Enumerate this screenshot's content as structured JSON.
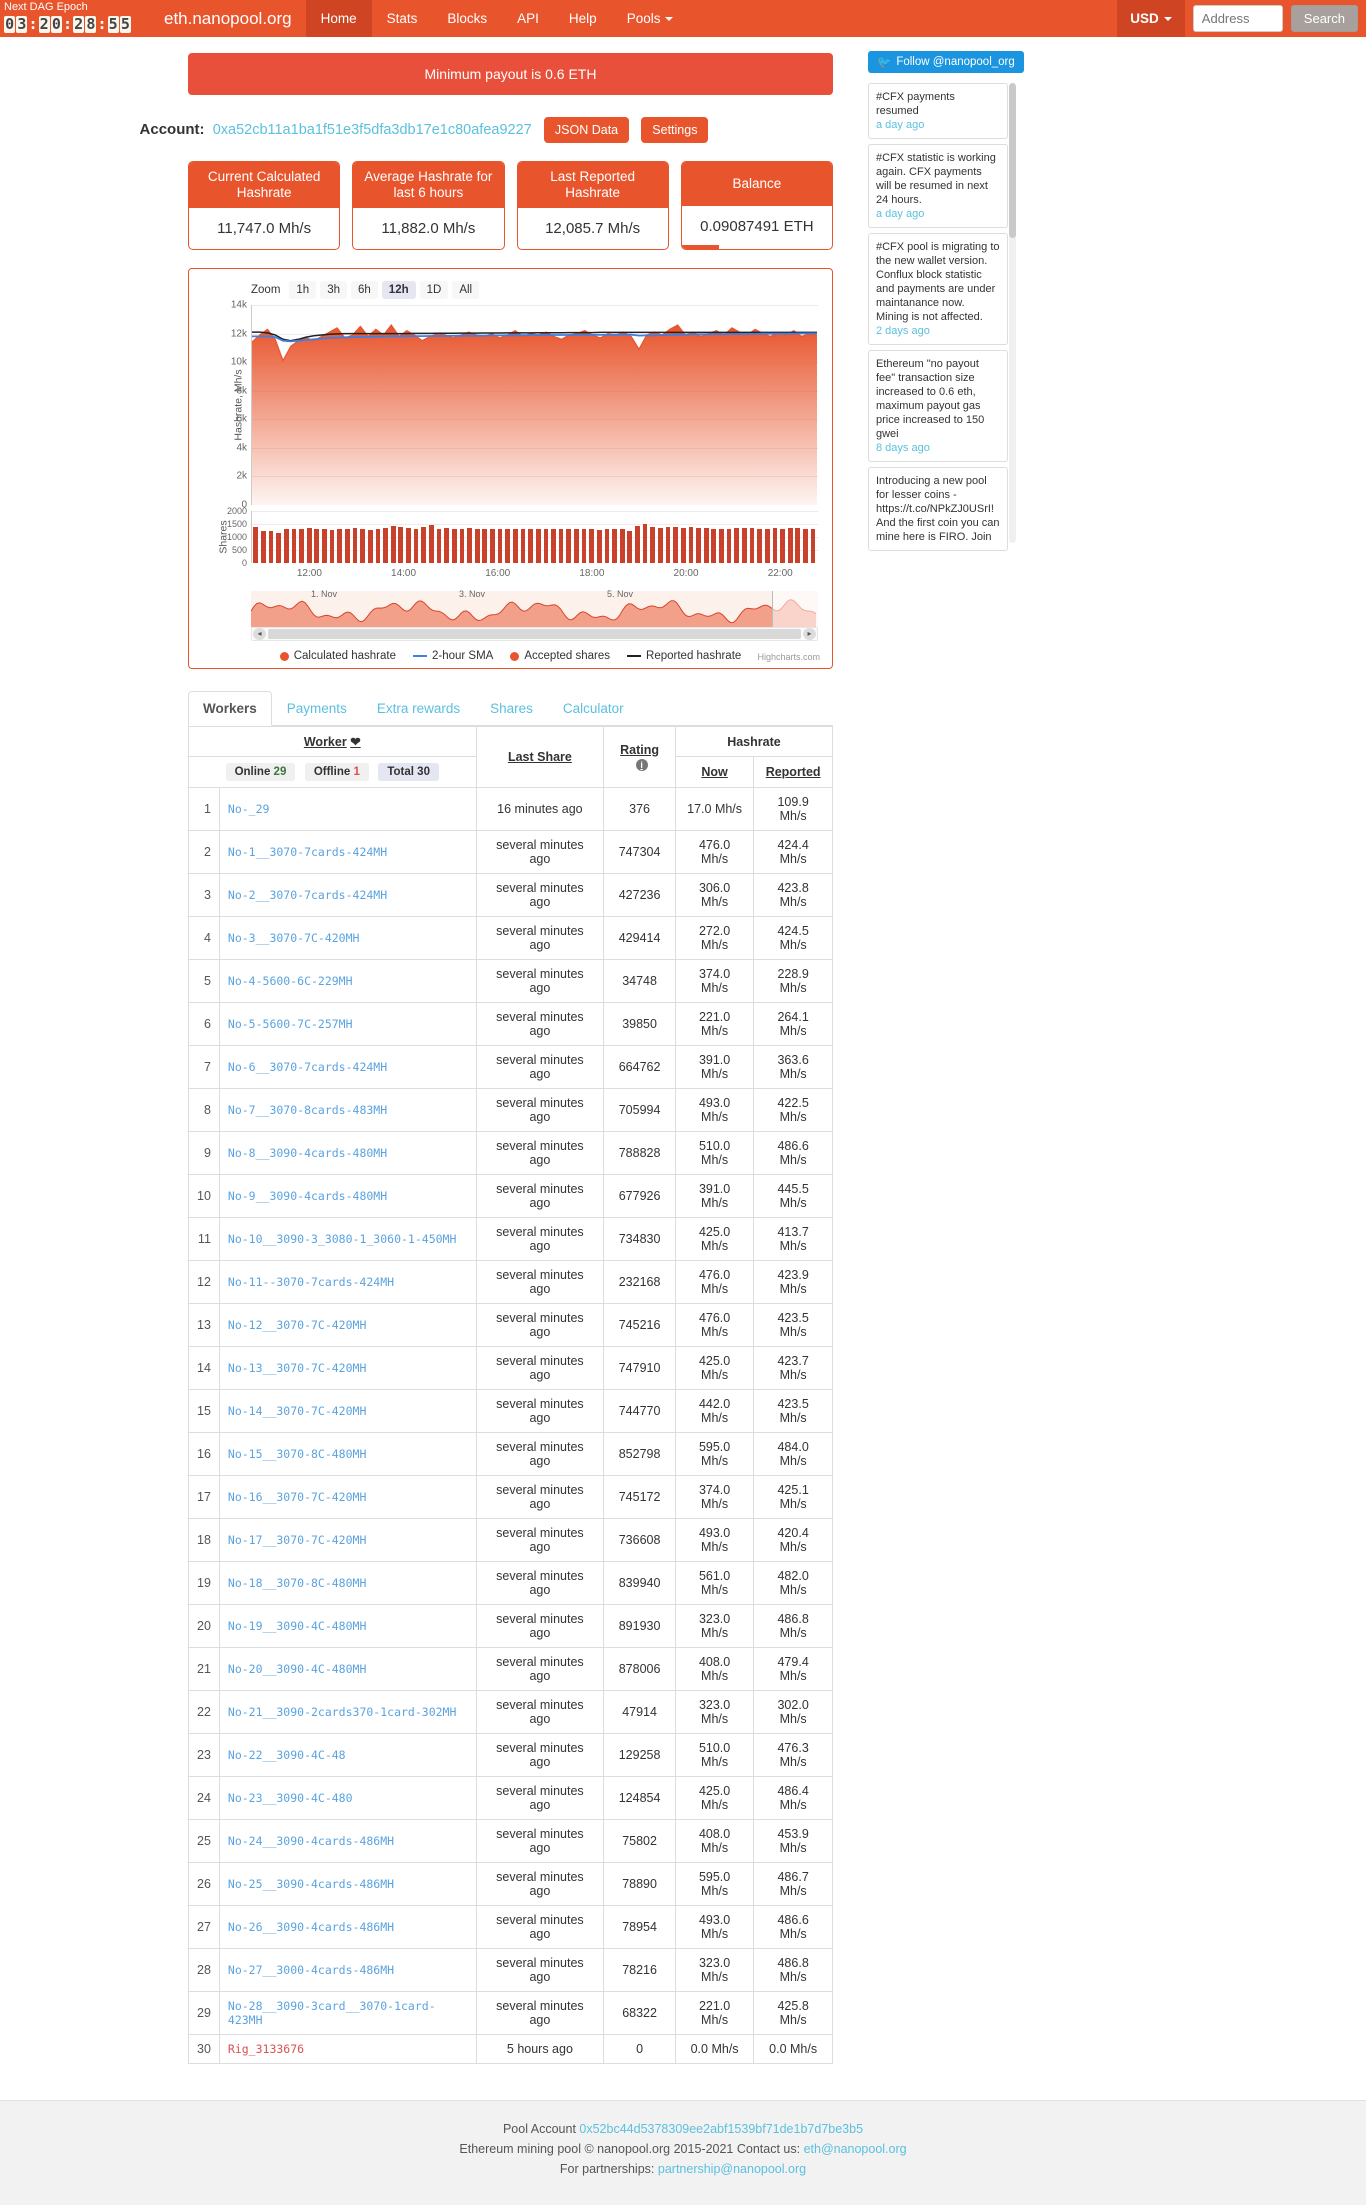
{
  "navbar": {
    "dag_title": "Next DAG Epoch",
    "dag_digits": [
      "0",
      "3",
      "2",
      "0",
      "2",
      "8",
      "5",
      "5"
    ],
    "brand": "eth.nanopool.org",
    "links": [
      {
        "label": "Home",
        "active": true
      },
      {
        "label": "Stats",
        "active": false
      },
      {
        "label": "Blocks",
        "active": false
      },
      {
        "label": "API",
        "active": false
      },
      {
        "label": "Help",
        "active": false
      },
      {
        "label": "Pools",
        "active": false,
        "caret": true
      }
    ],
    "currency": "USD",
    "address_placeholder": "Address",
    "search_label": "Search"
  },
  "banner": {
    "text": "Minimum payout is 0.6 ETH"
  },
  "account": {
    "label": "Account:",
    "address": "0xa52cb11a1ba1f51e3f5dfa3db17e1c80afea9227",
    "json_button": "JSON Data",
    "settings_button": "Settings"
  },
  "stats": [
    {
      "title": "Current Calculated Hashrate",
      "value": "11,747.0 Mh/s"
    },
    {
      "title": "Average Hashrate for last 6 hours",
      "value": "11,882.0 Mh/s"
    },
    {
      "title": "Last Reported Hashrate",
      "value": "12,085.7 Mh/s"
    },
    {
      "title": "Balance",
      "value": "0.09087491 ETH"
    }
  ],
  "chart_data": {
    "type": "area",
    "title": "",
    "zoom_label": "Zoom",
    "zoom_options": [
      "1h",
      "3h",
      "6h",
      "12h",
      "1D",
      "All"
    ],
    "zoom_selected": "12h",
    "ylabel": "Hashrate, Mh/s",
    "ylabel2": "Shares",
    "yticks": [
      "14k",
      "12k",
      "10k",
      "8k",
      "6k",
      "4k",
      "2k",
      "0"
    ],
    "ylim": [
      0,
      14000
    ],
    "yticks2": [
      "2000",
      "1500",
      "1000",
      "500",
      "0"
    ],
    "ylim2": [
      0,
      2000
    ],
    "xticks": [
      "12:00",
      "14:00",
      "16:00",
      "18:00",
      "20:00",
      "22:00"
    ],
    "xlabel": "",
    "grid": true,
    "legend_position": "bottom",
    "legend": [
      {
        "name": "Calculated hashrate",
        "marker": "dot",
        "color": "#e8552d"
      },
      {
        "name": "2-hour SMA",
        "marker": "line",
        "color": "#3f7fe0"
      },
      {
        "name": "Accepted shares",
        "marker": "dot",
        "color": "#e8552d"
      },
      {
        "name": "Reported hashrate",
        "marker": "line",
        "color": "#222222"
      }
    ],
    "credit": "Highcharts.com",
    "navigator_ticks": [
      "1. Nov",
      "3. Nov",
      "5. Nov"
    ],
    "series": [
      {
        "name": "Calculated hashrate",
        "color": "#e8552d",
        "values": [
          11400,
          11900,
          12300,
          11600,
          10100,
          11100,
          11500,
          11700,
          11500,
          11800,
          12100,
          12400,
          11700,
          11900,
          12500,
          11800,
          12300,
          11900,
          12600,
          11800,
          12200,
          11900,
          11500,
          11800,
          12000,
          11900,
          11700,
          11900,
          12100,
          11900,
          11800,
          12000,
          11700,
          11900,
          12200,
          11800,
          12000,
          11900,
          12100,
          11800,
          11600,
          11900,
          12000,
          12200,
          11900,
          11700,
          12000,
          11900,
          12100,
          11800,
          10900,
          11900,
          12100,
          11900,
          12300,
          12600,
          11900,
          12100,
          11800,
          12000,
          12200,
          11900,
          12400,
          12100,
          11900,
          12300,
          12000,
          11800,
          12100,
          11900,
          12200,
          11800,
          12000,
          11900
        ]
      },
      {
        "name": "2-hour SMA",
        "color": "#3f7fe0",
        "values": [
          11800,
          11800,
          11800,
          11750,
          11500,
          11450,
          11500,
          11550,
          11600,
          11650,
          11700,
          11720,
          11740,
          11750,
          11760,
          11770,
          11780,
          11790,
          11800,
          11800,
          11810,
          11820,
          11820,
          11830,
          11830,
          11840,
          11840,
          11850,
          11850,
          11860,
          11860,
          11870,
          11870,
          11880,
          11880,
          11890,
          11890,
          11900,
          11900,
          11900,
          11900,
          11900,
          11900,
          11910,
          11910,
          11910,
          11910,
          11920,
          11920,
          11920,
          11860,
          11870,
          11880,
          11890,
          11900,
          11920,
          11930,
          11940,
          11940,
          11950,
          11960,
          11960,
          11970,
          11970,
          11980,
          11980,
          11990,
          11990,
          12000,
          12000,
          12000,
          12010,
          12010,
          12010
        ]
      },
      {
        "name": "Reported hashrate",
        "color": "#222222",
        "values": [
          12100,
          12100,
          12050,
          11900,
          11600,
          11500,
          11600,
          11750,
          11850,
          11900,
          11950,
          11980,
          12000,
          12000,
          12000,
          12000,
          12000,
          12000,
          12000,
          12000,
          12000,
          12010,
          12010,
          12010,
          12020,
          12020,
          12020,
          12030,
          12030,
          12030,
          12040,
          12040,
          12040,
          12050,
          12050,
          12050,
          12050,
          12060,
          12060,
          12060,
          12060,
          12070,
          12070,
          12070,
          12070,
          12080,
          12080,
          12080,
          12080,
          12080,
          12080,
          12080,
          12080,
          12080,
          12080,
          12080,
          12080,
          12080,
          12080,
          12085,
          12085,
          12085,
          12085,
          12085,
          12085,
          12085,
          12085,
          12085,
          12085,
          12085,
          12085,
          12085,
          12085,
          12085
        ]
      },
      {
        "name": "Accepted shares",
        "color": "#c9412a",
        "type": "column",
        "values": [
          1390,
          1250,
          1240,
          1170,
          1300,
          1290,
          1290,
          1330,
          1320,
          1300,
          1280,
          1320,
          1290,
          1340,
          1300,
          1260,
          1290,
          1340,
          1420,
          1390,
          1350,
          1300,
          1370,
          1480,
          1300,
          1340,
          1300,
          1310,
          1330,
          1320,
          1310,
          1300,
          1290,
          1300,
          1310,
          1300,
          1310,
          1300,
          1290,
          1310,
          1300,
          1320,
          1310,
          1300,
          1290,
          1270,
          1300,
          1320,
          1310,
          1250,
          1420,
          1490,
          1370,
          1360,
          1380,
          1400,
          1360,
          1390,
          1330,
          1340,
          1300,
          1310,
          1320,
          1330,
          1340,
          1330,
          1320,
          1310,
          1330,
          1320,
          1340,
          1330,
          1320,
          1310
        ]
      }
    ]
  },
  "tabs": [
    {
      "label": "Workers",
      "active": true
    },
    {
      "label": "Payments",
      "active": false
    },
    {
      "label": "Extra rewards",
      "active": false
    },
    {
      "label": "Shares",
      "active": false
    },
    {
      "label": "Calculator",
      "active": false
    }
  ],
  "table": {
    "worker_header": "Worker",
    "worker_sort_icon": "chevron-down-icon",
    "status": {
      "online_label": "Online",
      "online_count": "29",
      "offline_label": "Offline",
      "offline_count": "1",
      "total_label": "Total",
      "total_count": "30"
    },
    "columns": {
      "last_share": "Last Share",
      "rating": "Rating",
      "hashrate": "Hashrate",
      "now": "Now",
      "reported": "Reported"
    },
    "rows": [
      {
        "idx": "1",
        "worker": "No-_29",
        "last_share": "16 minutes ago",
        "rating": "376",
        "now": "17.0 Mh/s",
        "reported": "109.9 Mh/s",
        "offline": false
      },
      {
        "idx": "2",
        "worker": "No-1__3070-7cards-424MH",
        "last_share": "several minutes ago",
        "rating": "747304",
        "now": "476.0 Mh/s",
        "reported": "424.4 Mh/s",
        "offline": false
      },
      {
        "idx": "3",
        "worker": "No-2__3070-7cards-424MH",
        "last_share": "several minutes ago",
        "rating": "427236",
        "now": "306.0 Mh/s",
        "reported": "423.8 Mh/s",
        "offline": false
      },
      {
        "idx": "4",
        "worker": "No-3__3070-7C-420MH",
        "last_share": "several minutes ago",
        "rating": "429414",
        "now": "272.0 Mh/s",
        "reported": "424.5 Mh/s",
        "offline": false
      },
      {
        "idx": "5",
        "worker": "No-4-5600-6C-229MH",
        "last_share": "several minutes ago",
        "rating": "34748",
        "now": "374.0 Mh/s",
        "reported": "228.9 Mh/s",
        "offline": false
      },
      {
        "idx": "6",
        "worker": "No-5-5600-7C-257MH",
        "last_share": "several minutes ago",
        "rating": "39850",
        "now": "221.0 Mh/s",
        "reported": "264.1 Mh/s",
        "offline": false
      },
      {
        "idx": "7",
        "worker": "No-6__3070-7cards-424MH",
        "last_share": "several minutes ago",
        "rating": "664762",
        "now": "391.0 Mh/s",
        "reported": "363.6 Mh/s",
        "offline": false
      },
      {
        "idx": "8",
        "worker": "No-7__3070-8cards-483MH",
        "last_share": "several minutes ago",
        "rating": "705994",
        "now": "493.0 Mh/s",
        "reported": "422.5 Mh/s",
        "offline": false
      },
      {
        "idx": "9",
        "worker": "No-8__3090-4cards-480MH",
        "last_share": "several minutes ago",
        "rating": "788828",
        "now": "510.0 Mh/s",
        "reported": "486.6 Mh/s",
        "offline": false
      },
      {
        "idx": "10",
        "worker": "No-9__3090-4cards-480MH",
        "last_share": "several minutes ago",
        "rating": "677926",
        "now": "391.0 Mh/s",
        "reported": "445.5 Mh/s",
        "offline": false
      },
      {
        "idx": "11",
        "worker": "No-10__3090-3_3080-1_3060-1-450MH",
        "last_share": "several minutes ago",
        "rating": "734830",
        "now": "425.0 Mh/s",
        "reported": "413.7 Mh/s",
        "offline": false
      },
      {
        "idx": "12",
        "worker": "No-11--3070-7cards-424MH",
        "last_share": "several minutes ago",
        "rating": "232168",
        "now": "476.0 Mh/s",
        "reported": "423.9 Mh/s",
        "offline": false
      },
      {
        "idx": "13",
        "worker": "No-12__3070-7C-420MH",
        "last_share": "several minutes ago",
        "rating": "745216",
        "now": "476.0 Mh/s",
        "reported": "423.5 Mh/s",
        "offline": false
      },
      {
        "idx": "14",
        "worker": "No-13__3070-7C-420MH",
        "last_share": "several minutes ago",
        "rating": "747910",
        "now": "425.0 Mh/s",
        "reported": "423.7 Mh/s",
        "offline": false
      },
      {
        "idx": "15",
        "worker": "No-14__3070-7C-420MH",
        "last_share": "several minutes ago",
        "rating": "744770",
        "now": "442.0 Mh/s",
        "reported": "423.5 Mh/s",
        "offline": false
      },
      {
        "idx": "16",
        "worker": "No-15__3070-8C-480MH",
        "last_share": "several minutes ago",
        "rating": "852798",
        "now": "595.0 Mh/s",
        "reported": "484.0 Mh/s",
        "offline": false
      },
      {
        "idx": "17",
        "worker": "No-16__3070-7C-420MH",
        "last_share": "several minutes ago",
        "rating": "745172",
        "now": "374.0 Mh/s",
        "reported": "425.1 Mh/s",
        "offline": false
      },
      {
        "idx": "18",
        "worker": "No-17__3070-7C-420MH",
        "last_share": "several minutes ago",
        "rating": "736608",
        "now": "493.0 Mh/s",
        "reported": "420.4 Mh/s",
        "offline": false
      },
      {
        "idx": "19",
        "worker": "No-18__3070-8C-480MH",
        "last_share": "several minutes ago",
        "rating": "839940",
        "now": "561.0 Mh/s",
        "reported": "482.0 Mh/s",
        "offline": false
      },
      {
        "idx": "20",
        "worker": "No-19__3090-4C-480MH",
        "last_share": "several minutes ago",
        "rating": "891930",
        "now": "323.0 Mh/s",
        "reported": "486.8 Mh/s",
        "offline": false
      },
      {
        "idx": "21",
        "worker": "No-20__3090-4C-480MH",
        "last_share": "several minutes ago",
        "rating": "878006",
        "now": "408.0 Mh/s",
        "reported": "479.4 Mh/s",
        "offline": false
      },
      {
        "idx": "22",
        "worker": "No-21__3090-2cards370-1card-302MH",
        "last_share": "several minutes ago",
        "rating": "47914",
        "now": "323.0 Mh/s",
        "reported": "302.0 Mh/s",
        "offline": false
      },
      {
        "idx": "23",
        "worker": "No-22__3090-4C-48",
        "last_share": "several minutes ago",
        "rating": "129258",
        "now": "510.0 Mh/s",
        "reported": "476.3 Mh/s",
        "offline": false
      },
      {
        "idx": "24",
        "worker": "No-23__3090-4C-480",
        "last_share": "several minutes ago",
        "rating": "124854",
        "now": "425.0 Mh/s",
        "reported": "486.4 Mh/s",
        "offline": false
      },
      {
        "idx": "25",
        "worker": "No-24__3090-4cards-486MH",
        "last_share": "several minutes ago",
        "rating": "75802",
        "now": "408.0 Mh/s",
        "reported": "453.9 Mh/s",
        "offline": false
      },
      {
        "idx": "26",
        "worker": "No-25__3090-4cards-486MH",
        "last_share": "several minutes ago",
        "rating": "78890",
        "now": "595.0 Mh/s",
        "reported": "486.7 Mh/s",
        "offline": false
      },
      {
        "idx": "27",
        "worker": "No-26__3090-4cards-486MH",
        "last_share": "several minutes ago",
        "rating": "78954",
        "now": "493.0 Mh/s",
        "reported": "486.6 Mh/s",
        "offline": false
      },
      {
        "idx": "28",
        "worker": "No-27__3000-4cards-486MH",
        "last_share": "several minutes ago",
        "rating": "78216",
        "now": "323.0 Mh/s",
        "reported": "486.8 Mh/s",
        "offline": false
      },
      {
        "idx": "29",
        "worker": "No-28__3090-3card__3070-1card-423MH",
        "last_share": "several minutes ago",
        "rating": "68322",
        "now": "221.0 Mh/s",
        "reported": "425.8 Mh/s",
        "offline": false
      },
      {
        "idx": "30",
        "worker": "Rig_3133676",
        "last_share": "5 hours ago",
        "rating": "0",
        "now": "0.0 Mh/s",
        "reported": "0.0 Mh/s",
        "offline": true
      }
    ]
  },
  "sidebar": {
    "twitter_label": "Follow @nanopool_org",
    "news": [
      {
        "text": "#CFX payments resumed",
        "time": "a day ago"
      },
      {
        "text": "#CFX statistic is working again. CFX payments will be resumed in next 24 hours.",
        "time": "a day ago"
      },
      {
        "text": "#CFX pool is migrating to the new wallet version. Conflux block statistic and payments are under maintanance now. Mining is not affected.",
        "time": "2 days ago"
      },
      {
        "text": "Ethereum \"no payout fee\" transaction size increased to 0.6 eth, maximum payout gas price increased to 150 gwei",
        "time": "8 days ago"
      },
      {
        "text": "Introducing a new pool for lesser coins - https://t.co/NPkZJ0USrI! And the first coin you can mine here is FIRO. Join",
        "time": ""
      }
    ]
  },
  "footer": {
    "pool_account_label": "Pool Account",
    "pool_account": "0x52bc44d5378309ee2abf1539bf71de1b7d7be3b5",
    "copyright": "Ethereum mining pool © nanopool.org 2015-2021 Contact us:",
    "contact_email": "eth@nanopool.org",
    "partnership_label": "For partnerships:",
    "partnership_email": "partnership@nanopool.org"
  }
}
